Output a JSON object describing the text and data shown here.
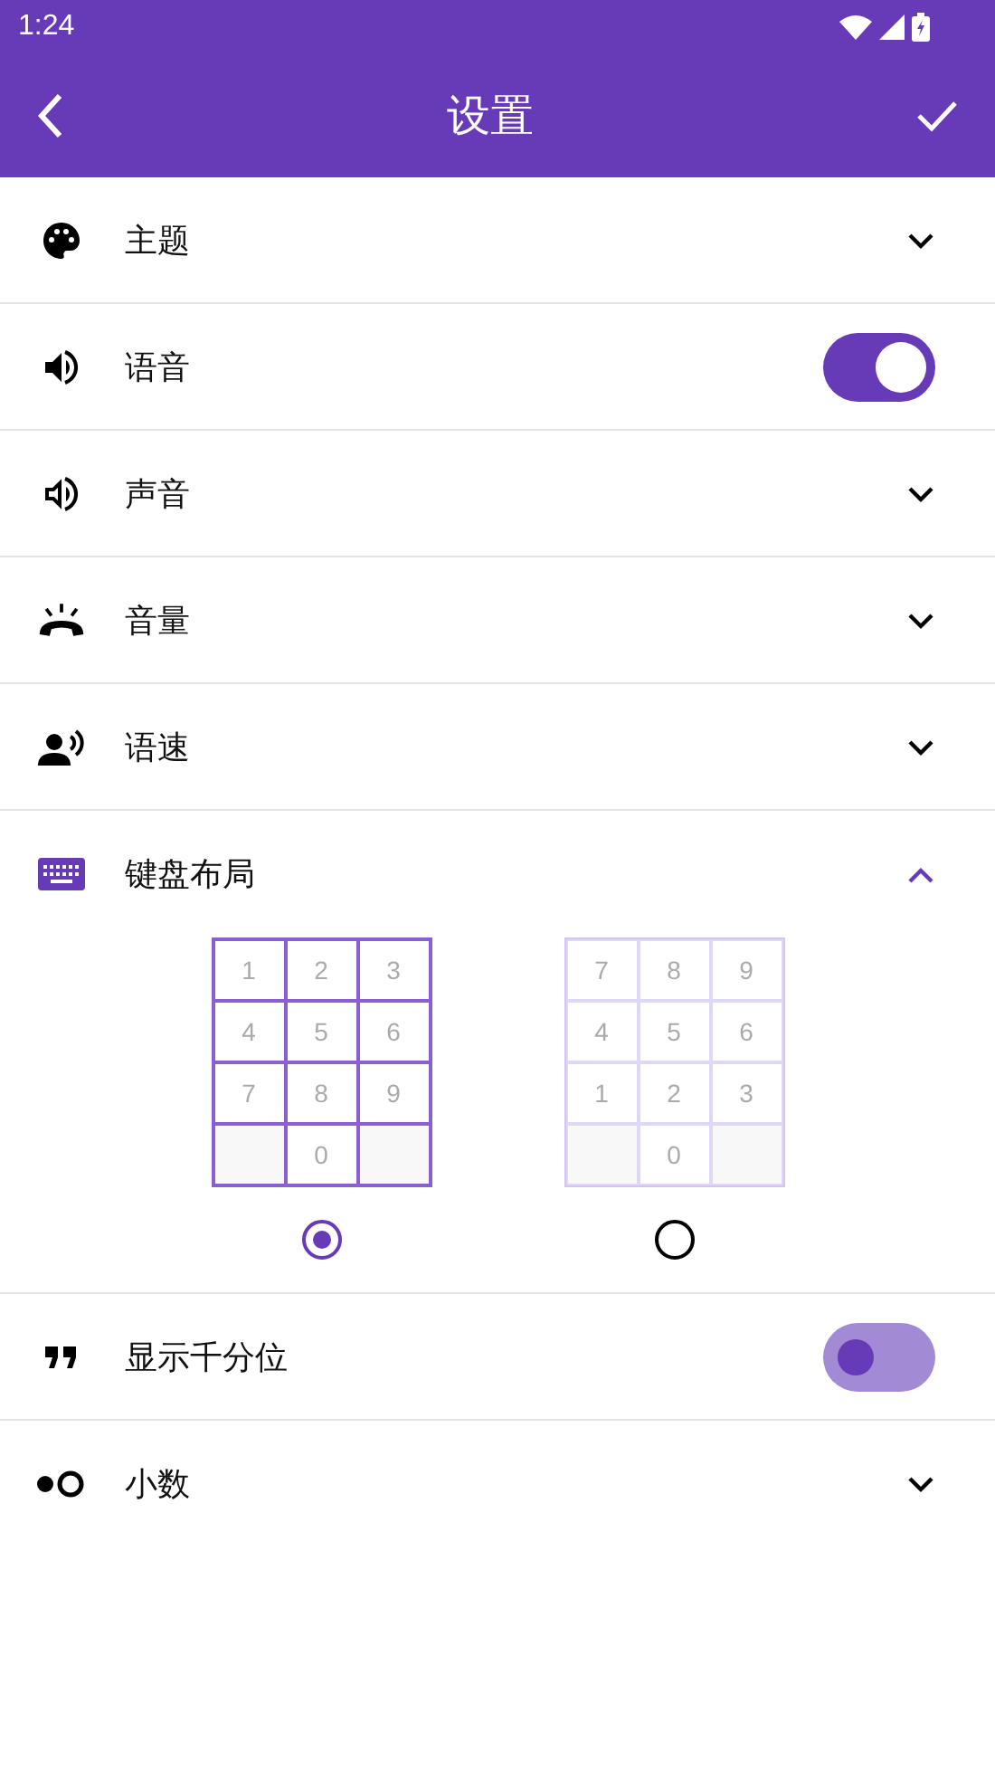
{
  "status_bar": {
    "time": "1:24"
  },
  "toolbar": {
    "title": "设置"
  },
  "settings": [
    {
      "label": "主题",
      "kind": "expand",
      "expanded": false
    },
    {
      "label": "语音",
      "kind": "toggle",
      "on": true
    },
    {
      "label": "声音",
      "kind": "expand",
      "expanded": false
    },
    {
      "label": "音量",
      "kind": "expand",
      "expanded": false
    },
    {
      "label": "语速",
      "kind": "expand",
      "expanded": false
    },
    {
      "label": "键盘布局",
      "kind": "expand",
      "expanded": true,
      "layouts": [
        {
          "selected": true,
          "keys": [
            [
              "1",
              "2",
              "3"
            ],
            [
              "4",
              "5",
              "6"
            ],
            [
              "7",
              "8",
              "9"
            ],
            [
              "0"
            ]
          ]
        },
        {
          "selected": false,
          "keys": [
            [
              "7",
              "8",
              "9"
            ],
            [
              "4",
              "5",
              "6"
            ],
            [
              "1",
              "2",
              "3"
            ],
            [
              "0"
            ]
          ]
        }
      ]
    },
    {
      "label": "显示千分位",
      "kind": "toggle",
      "on": false
    },
    {
      "label": "小数",
      "kind": "expand",
      "expanded": false
    }
  ]
}
